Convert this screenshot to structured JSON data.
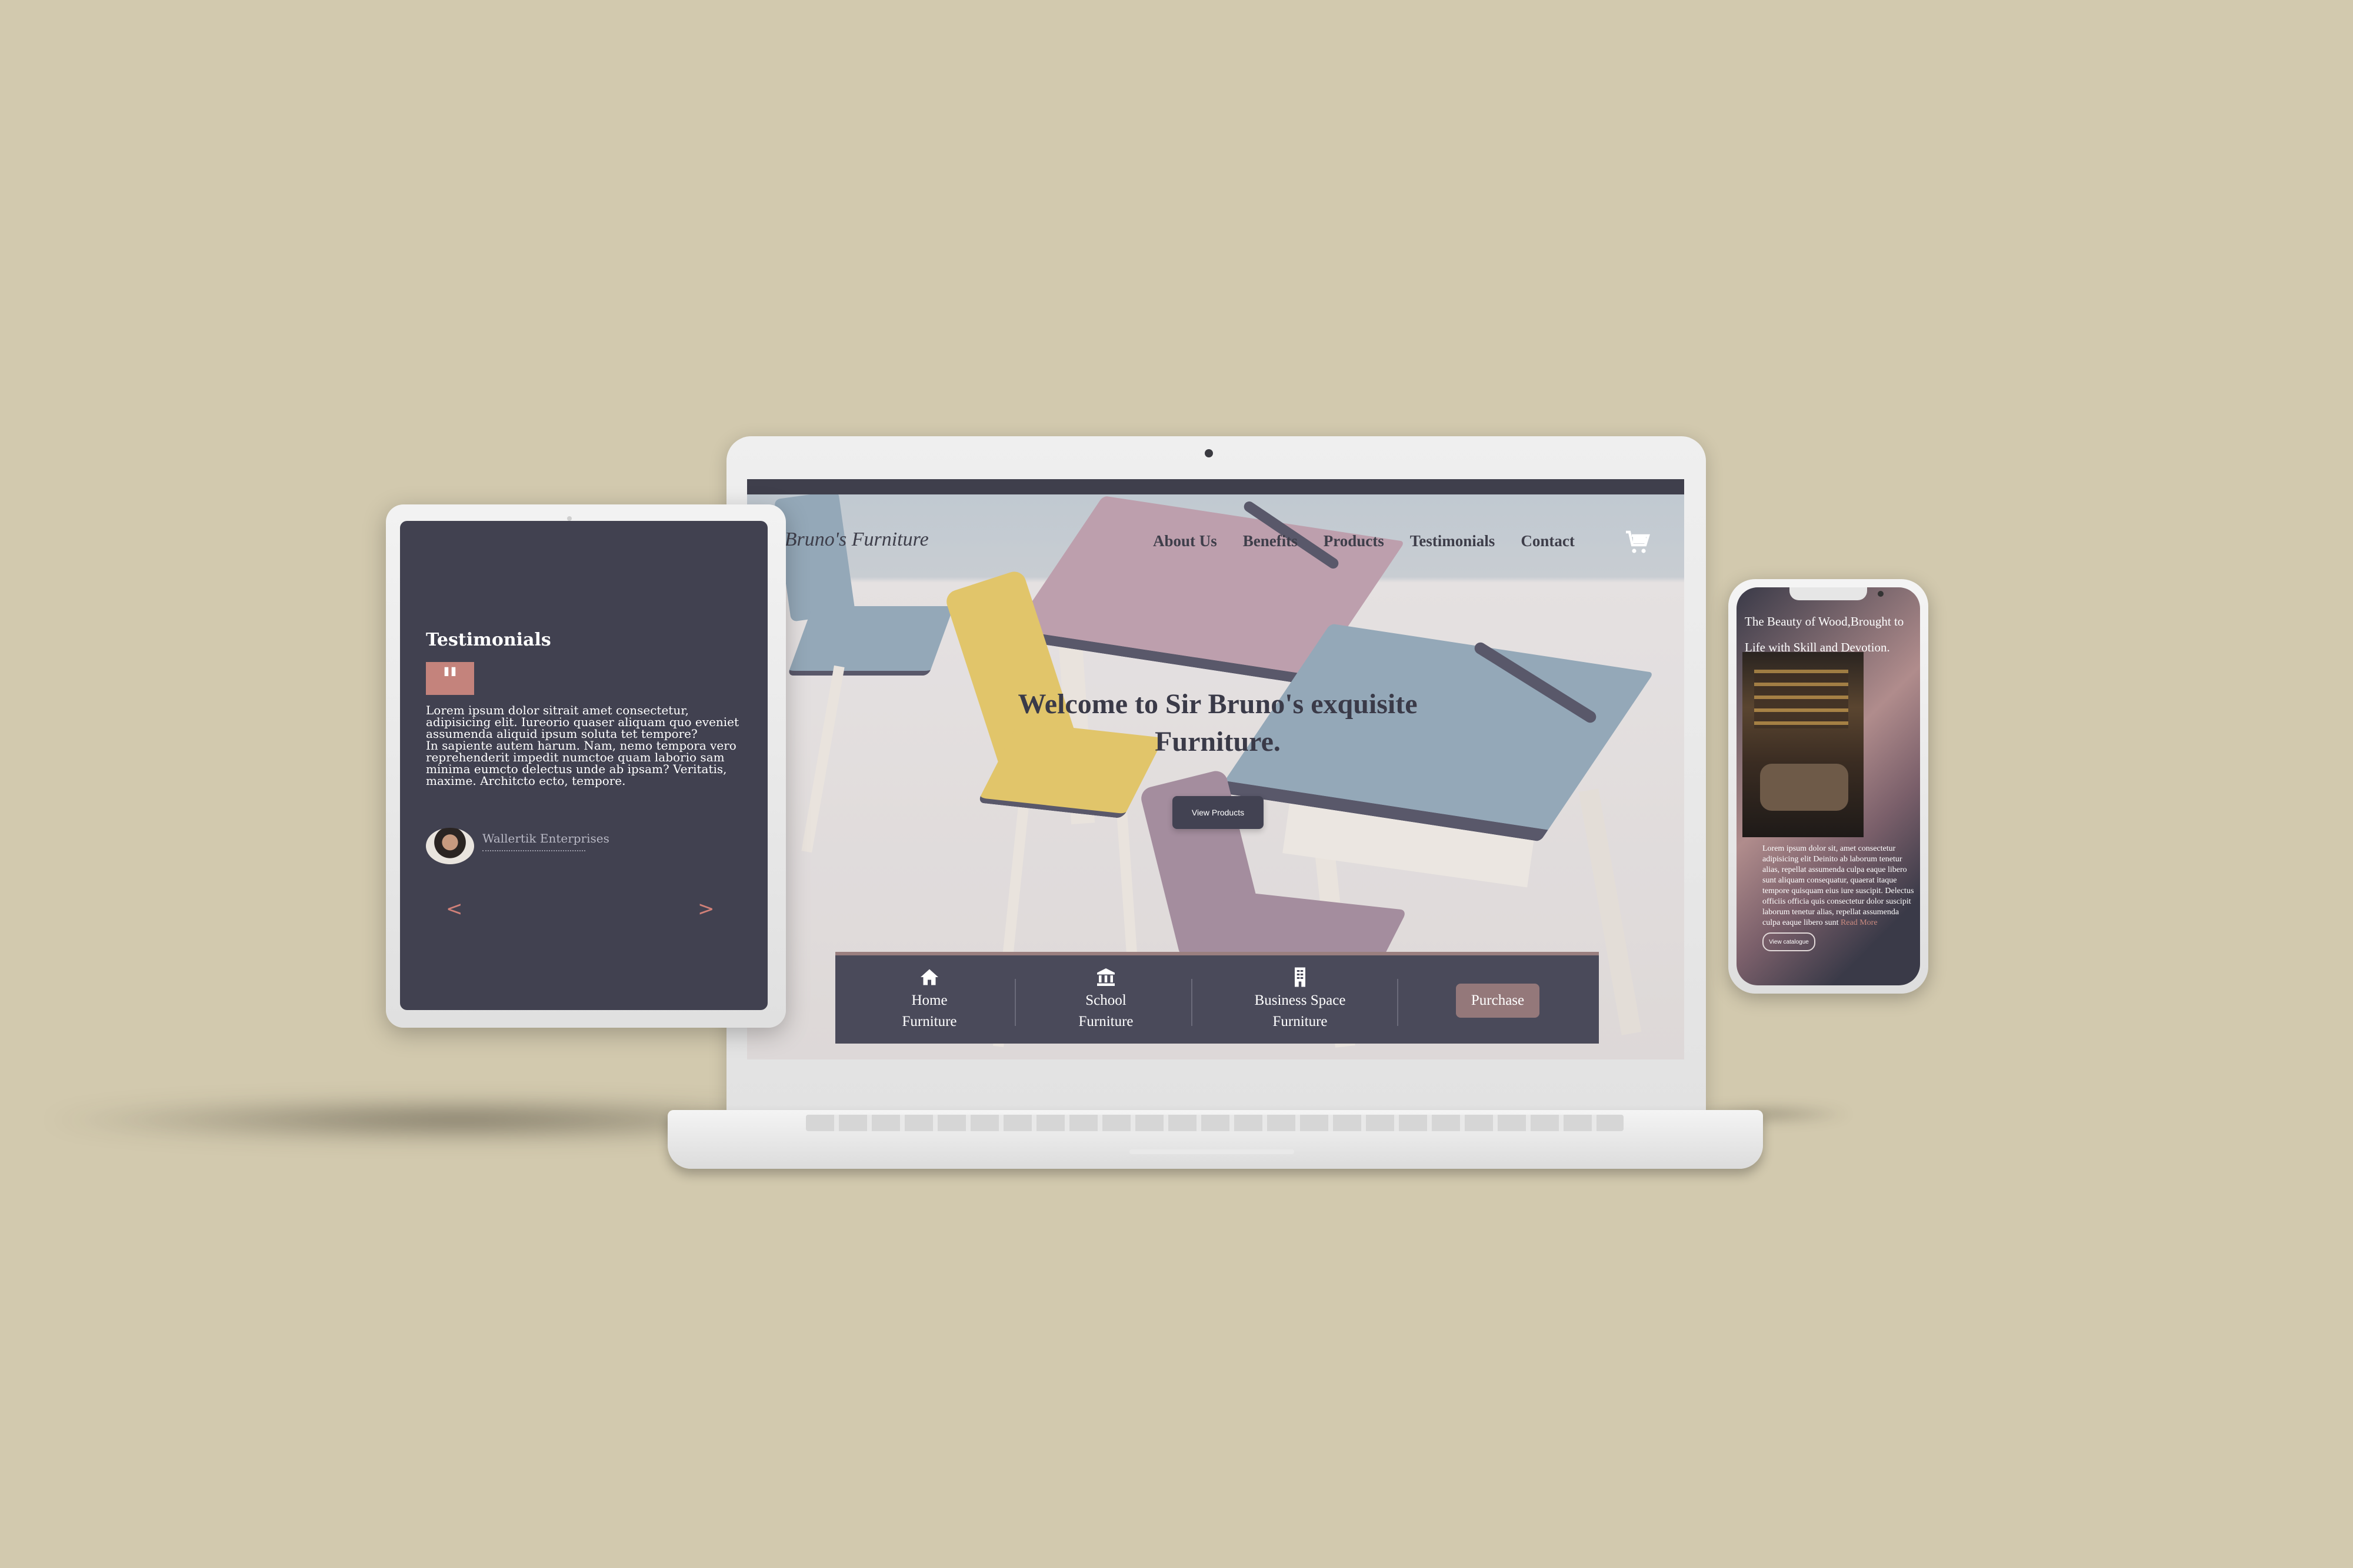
{
  "laptop": {
    "logo": "r Bruno's Furniture",
    "nav": [
      "About Us",
      "Benefits",
      "Products",
      "Testimonials",
      "Contact"
    ],
    "cart_icon": "cart-icon",
    "headline": "Welcome to Sir Bruno's exquisite Furniture.",
    "view_products": "View Products",
    "categories": [
      {
        "icon": "home-icon",
        "label": "Home Furniture"
      },
      {
        "icon": "school-icon",
        "label": "School Furniture"
      },
      {
        "icon": "building-icon",
        "label": "Business Space Furniture"
      }
    ],
    "purchase": "Purchase"
  },
  "tablet": {
    "title": "Testimonials",
    "quote_mark": "\"",
    "paragraph1": "Lorem ipsum dolor sitrait amet consectetur, adipisicing elit. Iureorio quaser aliquam quo eveniet assumenda aliquid ipsum soluta tet tempore?",
    "paragraph2": "In sapiente autem harum. Nam, nemo tempora vero reprehenderit impedit numctoe quam laborio sam minima eumcto delectus unde ab ipsam? Veritatis, maxime. Architcto ecto, tempore.",
    "company": "Wallertik Enterprises",
    "prev": "<",
    "next": ">"
  },
  "phone": {
    "headline": "The Beauty of Wood,Brought to Life with Skill and Devotion.",
    "body": "Lorem ipsum dolor sit, amet consectetur adipisicing elit Deinito ab laborum tenetur alias, repellat assumenda culpa eaque libero sunt aliquam consequatur, quaerat itaque tempore quisquam eius iure suscipit. Delectus officiis officia quis consectetur dolor suscipit laborum tenetur alias, repellat assumenda culpa eaque libero sunt",
    "read_more": "Read More",
    "button": "View catalogue"
  },
  "colors": {
    "background": "#d2c9ae",
    "dark_slate": "#414150",
    "accent_rose": "#c4837c",
    "purchase": "#94787a"
  }
}
